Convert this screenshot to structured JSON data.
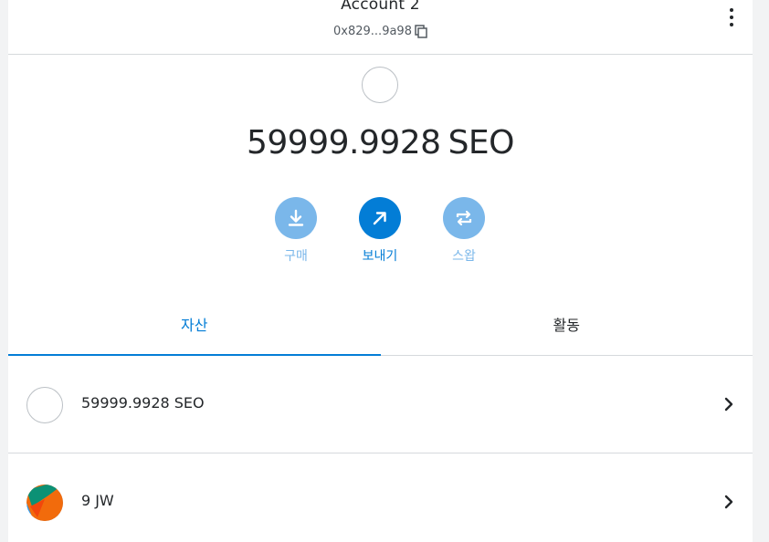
{
  "header": {
    "account_name": "Account 2",
    "address": "0x829...9a98",
    "copy_icon": "copy-icon",
    "menu_icon": "kebab-menu-icon"
  },
  "balance": {
    "amount": "59999.9928",
    "ticker": "SEO"
  },
  "actions": [
    {
      "label": "구매",
      "icon": "download-icon"
    },
    {
      "label": "보내기",
      "icon": "arrow-up-right-icon"
    },
    {
      "label": "스왑",
      "icon": "swap-icon"
    }
  ],
  "tabs": [
    {
      "label": "자산",
      "active": true
    },
    {
      "label": "활동",
      "active": false
    }
  ],
  "assets": [
    {
      "amount": "59999.9928",
      "ticker": "SEO"
    },
    {
      "amount": "9",
      "ticker": "JW"
    }
  ],
  "colors": {
    "primary": "#037dd6",
    "primary_light": "#7ab7ea",
    "text": "#24272a",
    "border": "#d6d9dc"
  }
}
